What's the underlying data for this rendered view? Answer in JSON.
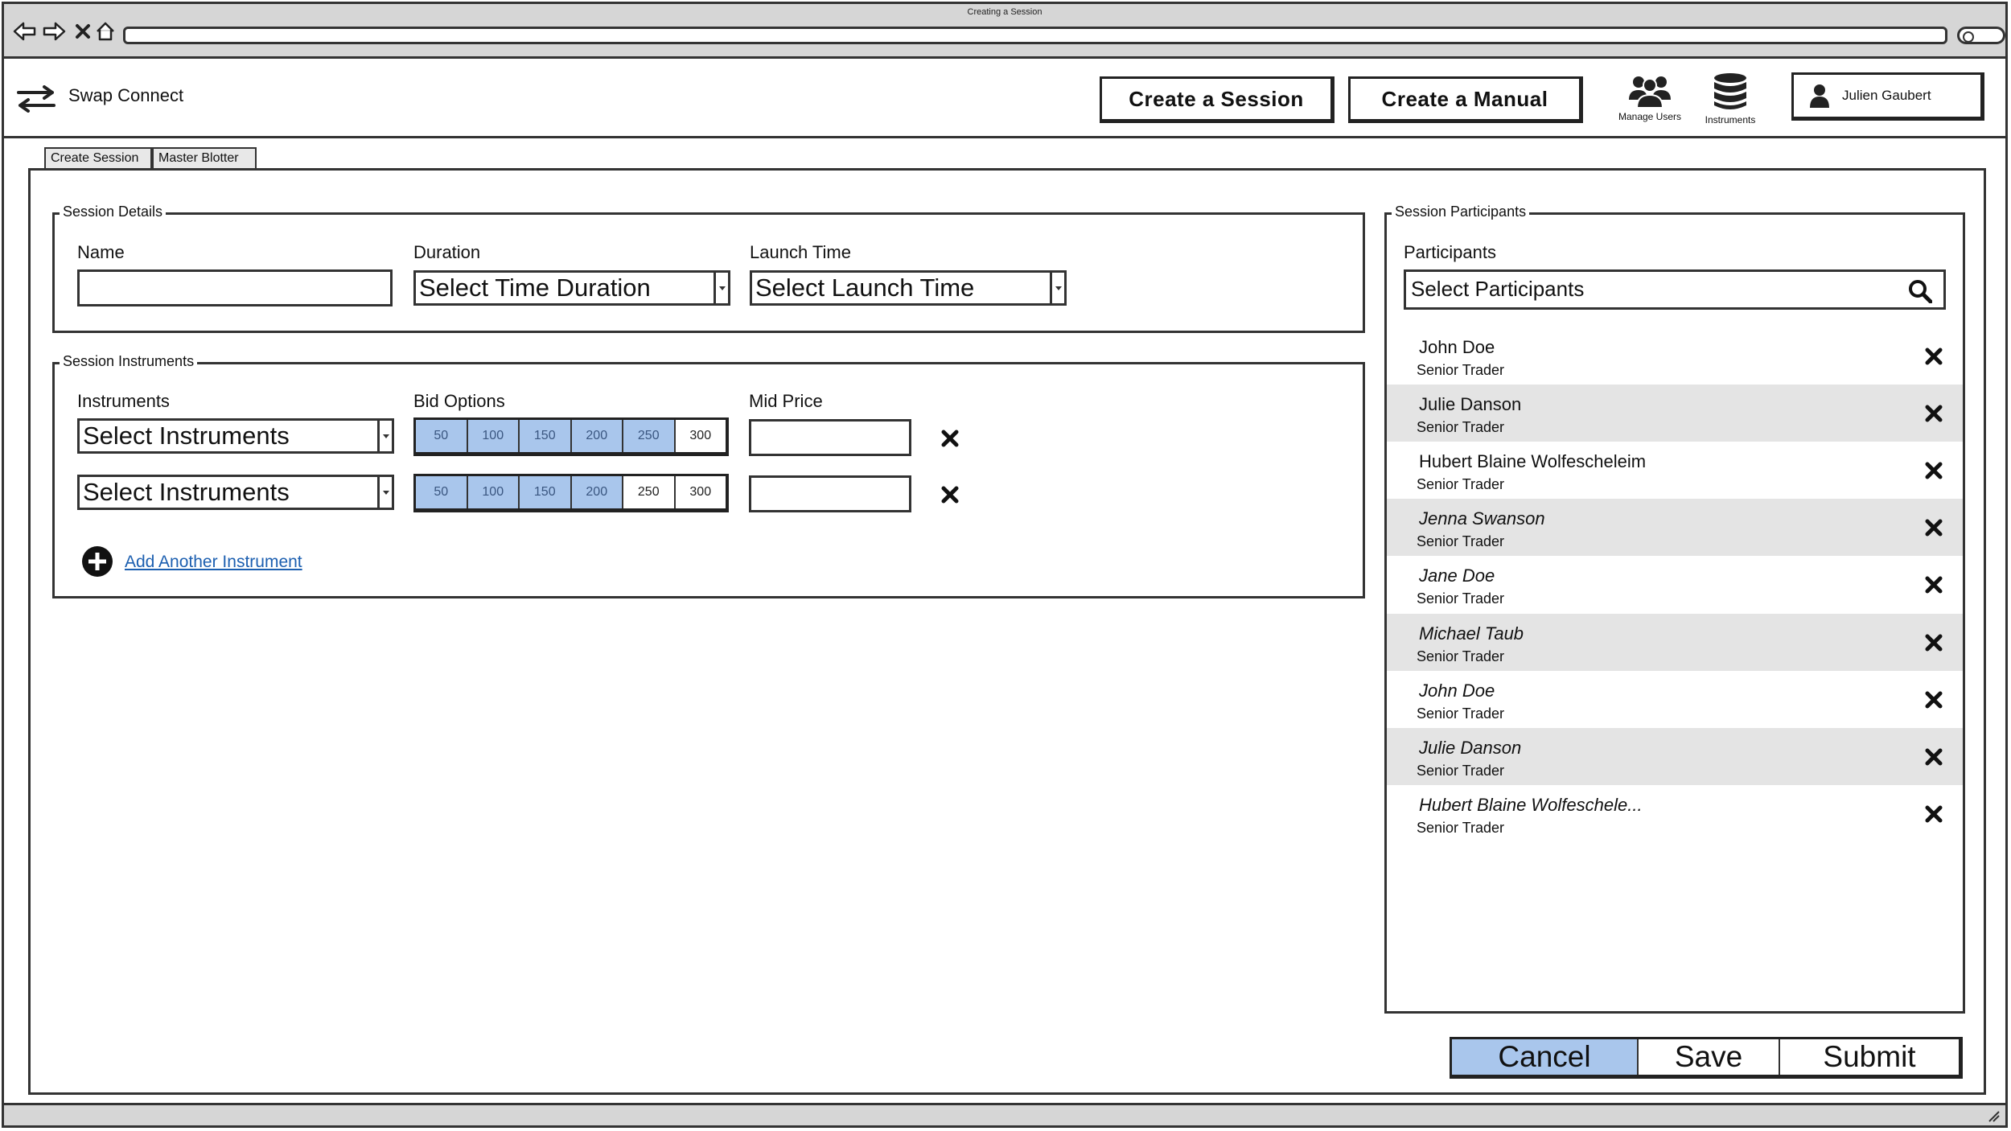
{
  "browser": {
    "title": "Creating a Session"
  },
  "app": {
    "name": "Swap Connect",
    "create_session_label": "Create a Session",
    "create_manual_label": "Create a Manual",
    "manage_users_label": "Manage Users",
    "instruments_label": "Instruments",
    "user_name": "Julien Gaubert"
  },
  "tabs": [
    {
      "label": "Create Session"
    },
    {
      "label": "Master Blotter"
    }
  ],
  "session_details": {
    "legend": "Session Details",
    "name_label": "Name",
    "name_value": "",
    "duration_label": "Duration",
    "duration_value": "Select Time Duration",
    "launch_label": "Launch Time",
    "launch_value": "Select Launch Time"
  },
  "session_instruments": {
    "legend": "Session Instruments",
    "instruments_label": "Instruments",
    "bid_options_label": "Bid Options",
    "mid_price_label": "Mid Price",
    "bid_values": [
      "50",
      "100",
      "150",
      "200",
      "250",
      "300"
    ],
    "rows": [
      {
        "instrument": "Select Instruments",
        "selected_count": 5,
        "mid_price": ""
      },
      {
        "instrument": "Select Instruments",
        "selected_count": 4,
        "mid_price": ""
      }
    ],
    "add_label": "Add Another Instrument"
  },
  "participants": {
    "legend": "Session Participants",
    "label": "Participants",
    "placeholder": "Select Participants",
    "items": [
      {
        "name": "John Doe",
        "role": "Senior Trader"
      },
      {
        "name": "Julie Danson",
        "role": "Senior Trader"
      },
      {
        "name": "Hubert Blaine Wolfescheleim",
        "role": "Senior Trader"
      },
      {
        "name": "Jenna Swanson",
        "role": "Senior Trader"
      },
      {
        "name": "Jane Doe",
        "role": "Senior Trader"
      },
      {
        "name": "Michael Taub",
        "role": "Senior Trader"
      },
      {
        "name": "John Doe",
        "role": "Senior Trader"
      },
      {
        "name": "Julie Danson",
        "role": "Senior Trader"
      },
      {
        "name": "Hubert Blaine Wolfeschele...",
        "role": "Senior Trader"
      }
    ]
  },
  "actions": {
    "cancel_label": "Cancel",
    "save_label": "Save",
    "submit_label": "Submit"
  },
  "colors": {
    "accent": "#a9c6ec",
    "link": "#1c5fb0",
    "chrome": "#d6d6d6",
    "row_alt": "#e4e4e4"
  }
}
